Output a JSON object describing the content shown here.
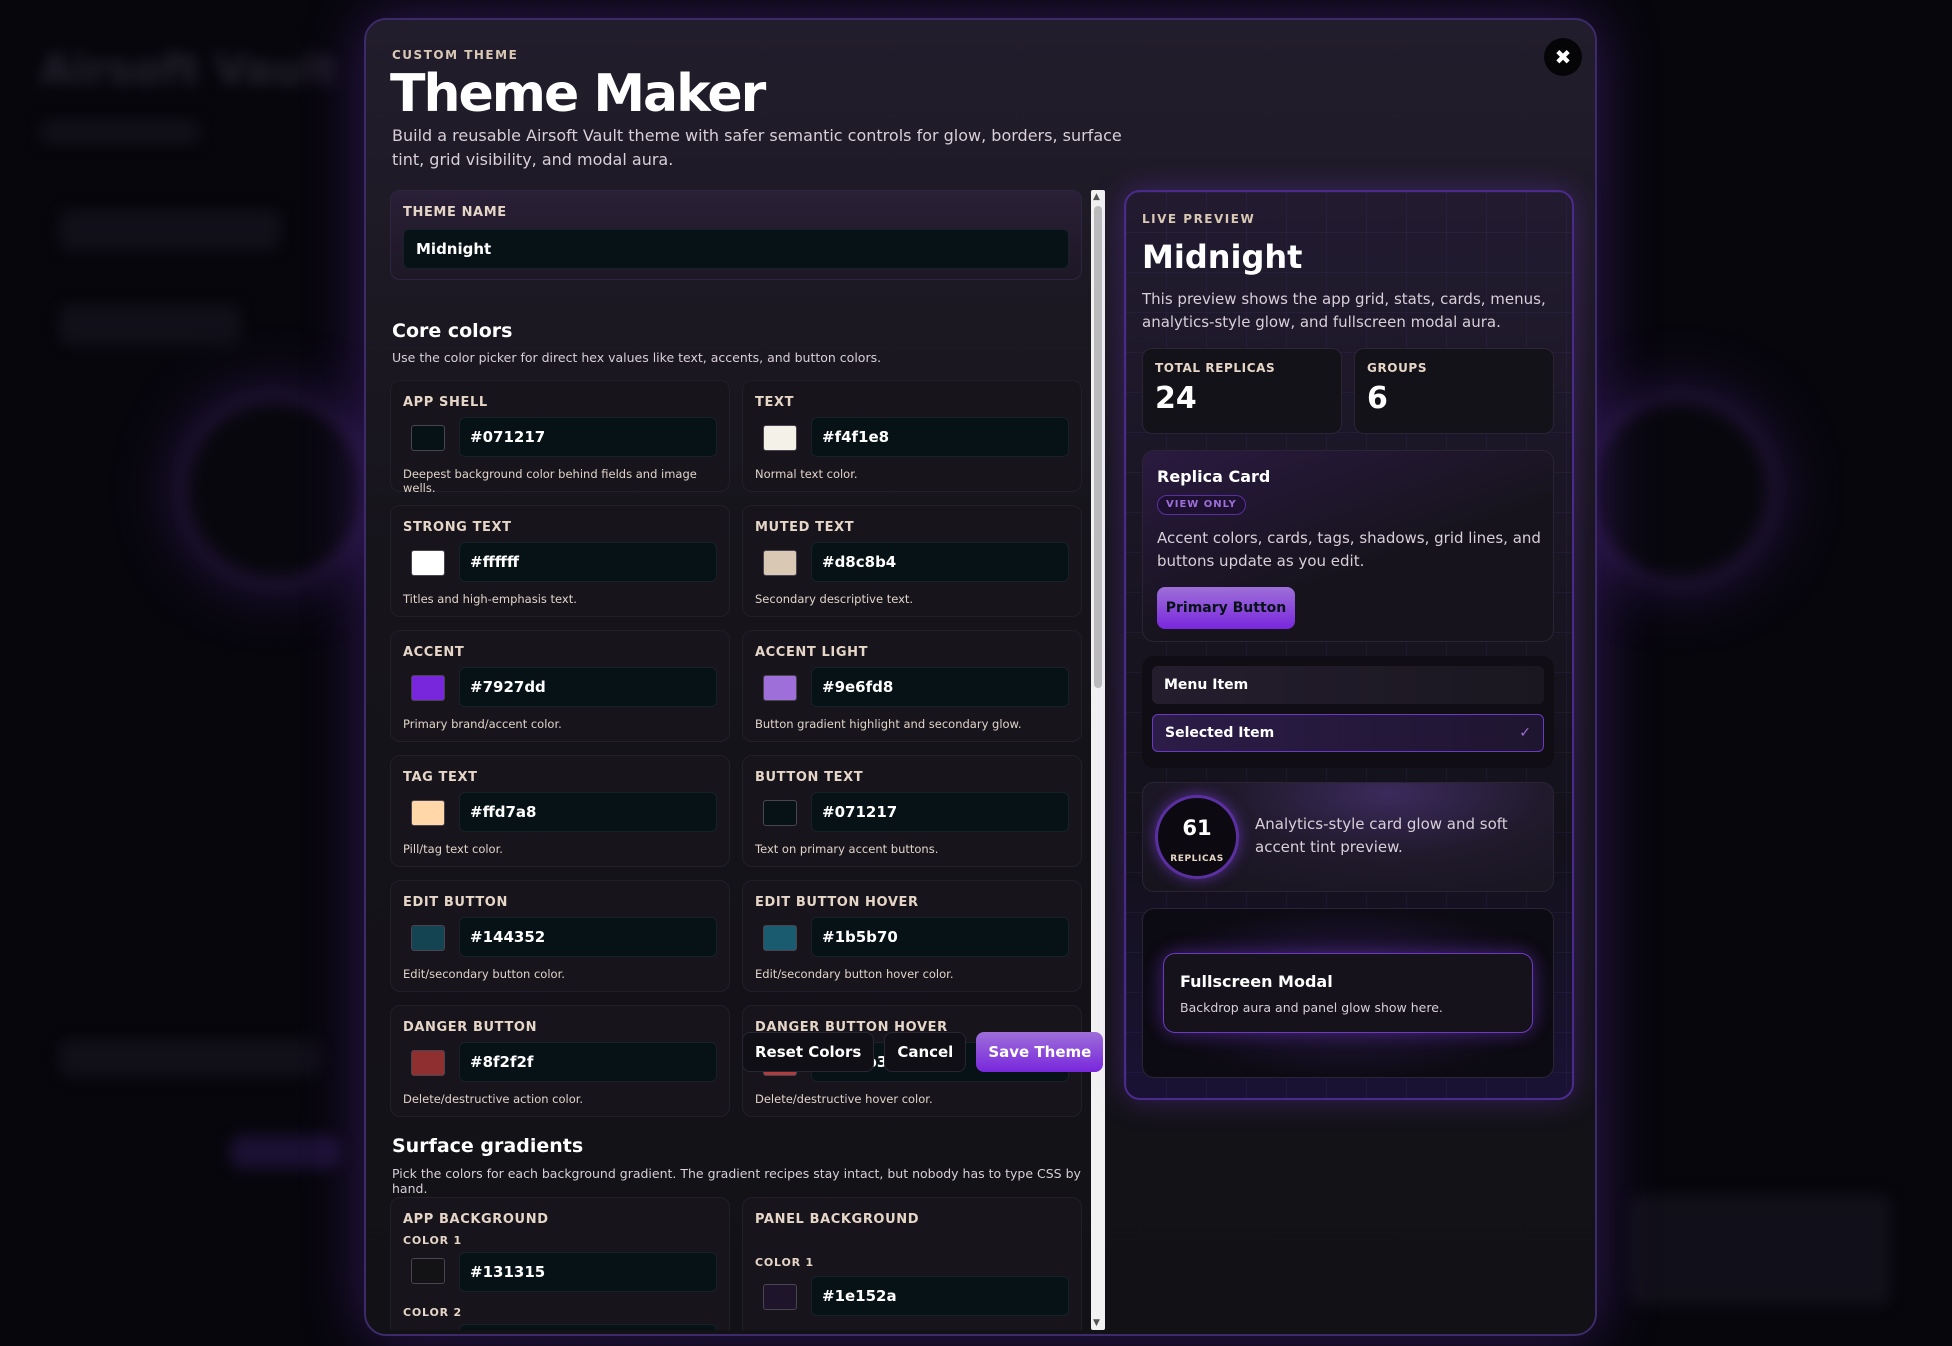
{
  "background_app": {
    "title": "Airsoft Vault"
  },
  "modal": {
    "eyebrow": "CUSTOM THEME",
    "title": "Theme Maker",
    "subtitle": "Build a reusable Airsoft Vault theme with safer semantic controls for glow, borders, surface tint, grid visibility, and modal aura.",
    "close_icon": "close-icon"
  },
  "theme_name": {
    "label": "THEME NAME",
    "value": "Midnight"
  },
  "core_colors": {
    "title": "Core colors",
    "description": "Use the color picker for direct hex values like text, accents, and button colors.",
    "fields": [
      {
        "label": "APP SHELL",
        "hex": "#071217",
        "hint": "Deepest background color behind fields and image wells."
      },
      {
        "label": "TEXT",
        "hex": "#f4f1e8",
        "hint": "Normal text color."
      },
      {
        "label": "STRONG TEXT",
        "hex": "#ffffff",
        "hint": "Titles and high-emphasis text."
      },
      {
        "label": "MUTED TEXT",
        "hex": "#d8c8b4",
        "hint": "Secondary descriptive text."
      },
      {
        "label": "ACCENT",
        "hex": "#7927dd",
        "hint": "Primary brand/accent color."
      },
      {
        "label": "ACCENT LIGHT",
        "hex": "#9e6fd8",
        "hint": "Button gradient highlight and secondary glow."
      },
      {
        "label": "TAG TEXT",
        "hex": "#ffd7a8",
        "hint": "Pill/tag text color."
      },
      {
        "label": "BUTTON TEXT",
        "hex": "#071217",
        "hint": "Text on primary accent buttons."
      },
      {
        "label": "EDIT BUTTON",
        "hex": "#144352",
        "hint": "Edit/secondary button color."
      },
      {
        "label": "EDIT BUTTON HOVER",
        "hex": "#1b5b70",
        "hint": "Edit/secondary button hover color."
      },
      {
        "label": "DANGER BUTTON",
        "hex": "#8f2f2f",
        "hint": "Delete/destructive action color."
      },
      {
        "label": "DANGER BUTTON HOVER",
        "hex": "#b23b3b",
        "hint": "Delete/destructive hover color."
      }
    ]
  },
  "surface_gradients": {
    "title": "Surface gradients",
    "description": "Pick the colors for each background gradient. The gradient recipes stay intact, but nobody has to type CSS by hand.",
    "app_background": {
      "label": "APP BACKGROUND",
      "color1_label": "COLOR 1",
      "color1_hex": "#131315",
      "color2_label": "COLOR 2"
    },
    "panel_background": {
      "label": "PANEL BACKGROUND",
      "color1_label": "COLOR 1",
      "color1_hex": "#1e152a"
    }
  },
  "footer": {
    "reset_label": "Reset Colors",
    "cancel_label": "Cancel",
    "save_label": "Save Theme"
  },
  "preview": {
    "eyebrow": "LIVE PREVIEW",
    "title": "Midnight",
    "description": "This preview shows the app grid, stats, cards, menus, analytics-style glow, and fullscreen modal aura.",
    "stats": [
      {
        "label": "TOTAL REPLICAS",
        "value": "24"
      },
      {
        "label": "GROUPS",
        "value": "6"
      }
    ],
    "card": {
      "title": "Replica Card",
      "tag": "VIEW ONLY",
      "description": "Accent colors, cards, tags, shadows, grid lines, and buttons update as you edit.",
      "button": "Primary Button"
    },
    "menu": {
      "item": "Menu Item",
      "selected_item": "Selected Item",
      "check": "✓"
    },
    "analytics": {
      "number": "61",
      "label": "REPLICAS",
      "description": "Analytics-style card glow and soft accent tint preview."
    },
    "modal_preview": {
      "title": "Fullscreen Modal",
      "description": "Backdrop aura and panel glow show here."
    }
  }
}
